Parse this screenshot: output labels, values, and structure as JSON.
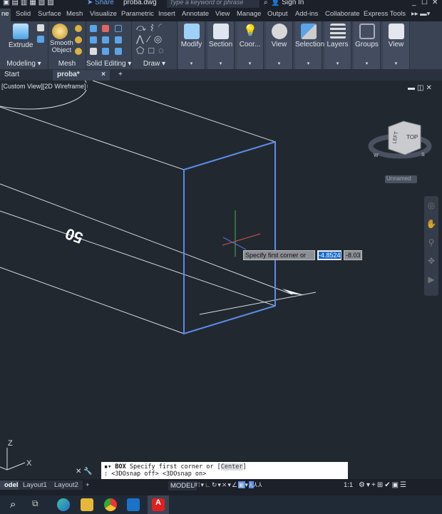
{
  "title_bar": {
    "share": "Share",
    "filename": "proba.dwg",
    "search_placeholder": "Type a keyword or phrase",
    "sign_in": "Sign In"
  },
  "ribbon_tabs": [
    "ne",
    "Solid",
    "Surface",
    "Mesh",
    "Visualize",
    "Parametric",
    "Insert",
    "Annotate",
    "View",
    "Manage",
    "Output",
    "Add-ins",
    "Collaborate",
    "Express Tools"
  ],
  "ribbon": {
    "modeling": {
      "extrude": "Extrude",
      "label": "Modeling"
    },
    "mesh": {
      "smooth_object_1": "Smooth",
      "smooth_object_2": "Object",
      "label": "Mesh"
    },
    "solid_editing": {
      "label": "Solid Editing"
    },
    "draw": {
      "label": "Draw"
    },
    "panels": [
      "Modify",
      "Section",
      "Coor...",
      "View",
      "Selection",
      "Layers",
      "Groups",
      "View"
    ]
  },
  "file_tabs": {
    "start": "Start",
    "active": "proba*",
    "close": "×",
    "add": "+"
  },
  "viewport": {
    "label": "[Custom View][2D Wireframe]",
    "dimension_text": "50",
    "viewcube": {
      "left": "LEFT",
      "top": "TOP",
      "w": "W",
      "s": "S"
    },
    "named_view": "Unnamed"
  },
  "dynamic_input": {
    "prompt": "Specify first corner or",
    "x_value": "-4.8524",
    "y_value": "-8.03"
  },
  "ucs": {
    "z": "Z",
    "x": "X"
  },
  "command_line": {
    "line1_cmd": "BOX",
    "line1_text": "Specify first corner or [",
    "line1_option": "Center",
    "line1_end": "]",
    "line2": ":  <3DOsnap off>  <3DOsnap on>"
  },
  "layout_tabs": [
    "odel",
    "Layout1",
    "Layout2",
    "+"
  ],
  "status_bar": {
    "model": "MODEL",
    "scale": "1:1"
  },
  "colors": {
    "viewport_bg": "#212830",
    "ribbon_bg": "#3a4353",
    "selection_blue": "#5b8ce6",
    "accent": "#1769d1"
  }
}
